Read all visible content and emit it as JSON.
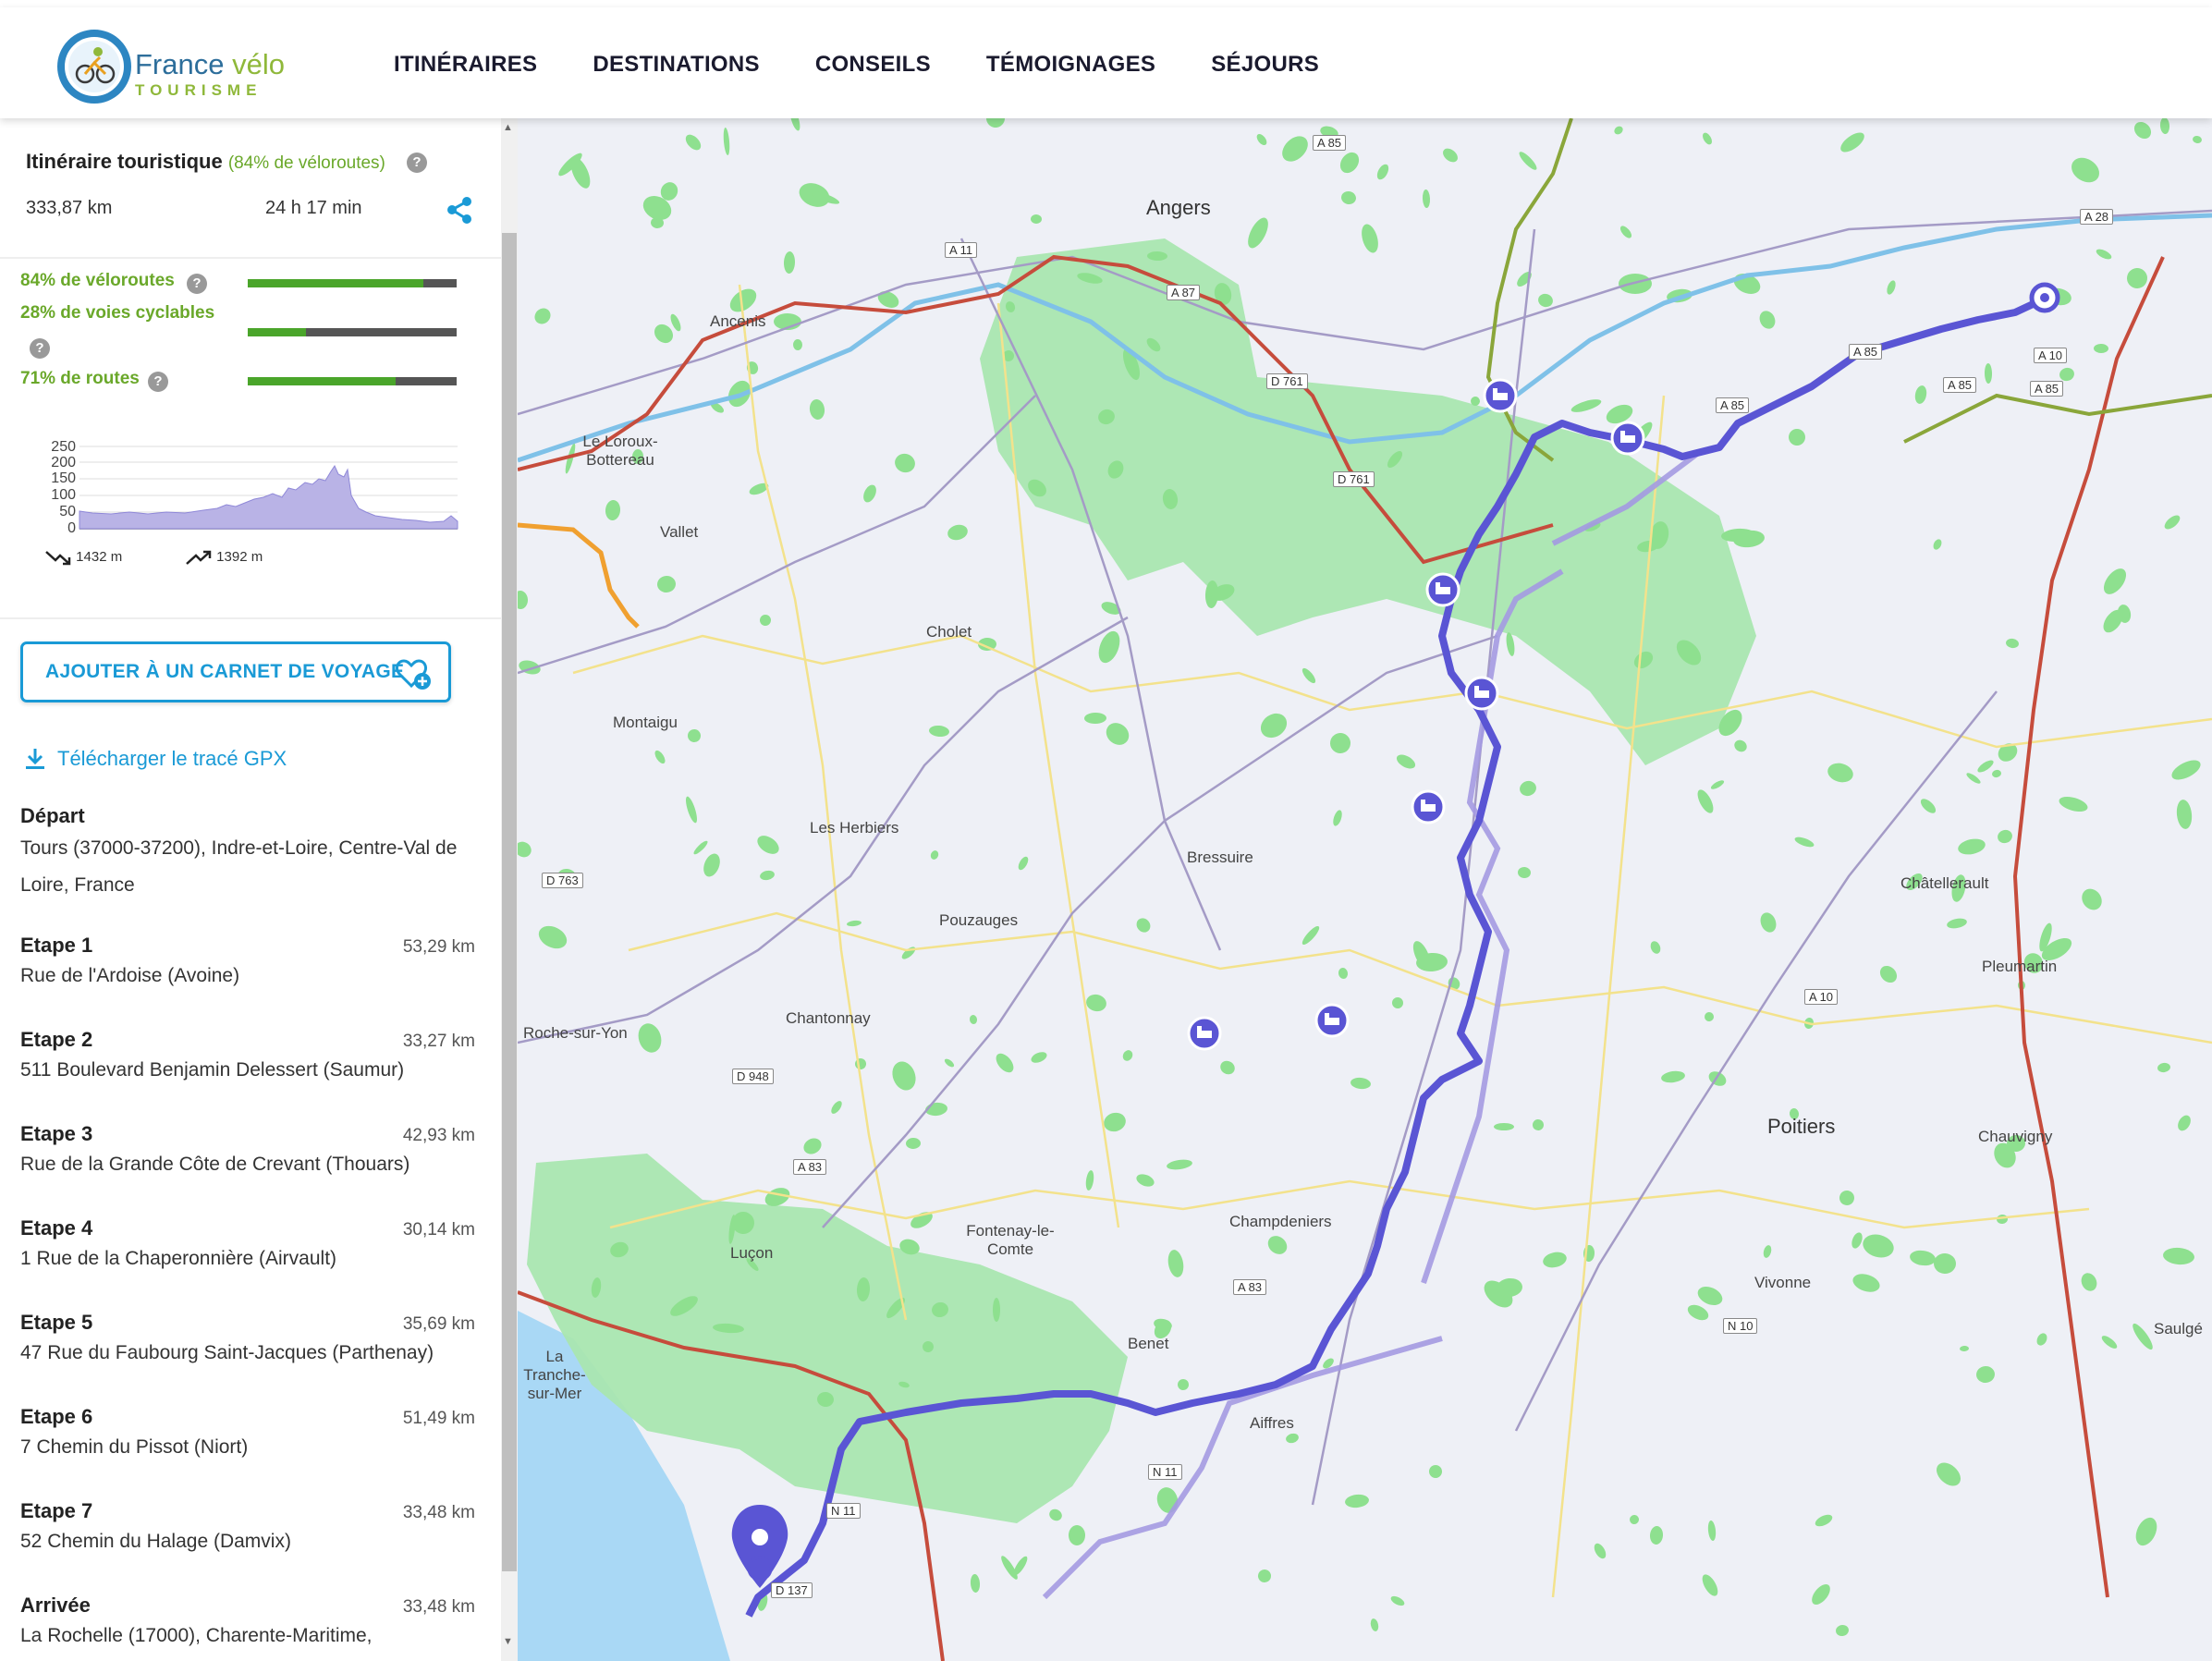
{
  "header": {
    "logo_line1": "France",
    "logo_line1b": "vélo",
    "logo_line2": "TOURISME",
    "nav": [
      "ITINÉRAIRES",
      "DESTINATIONS",
      "CONSEILS",
      "TÉMOIGNAGES",
      "SÉJOURS"
    ]
  },
  "summary": {
    "title": "Itinéraire touristique",
    "title_pct": "(84% de véloroutes)",
    "distance": "333,87 km",
    "duration": "24 h 17 min"
  },
  "stats": [
    {
      "label": "84% de véloroutes",
      "fraction": 0.84
    },
    {
      "label": "28% de voies cyclables",
      "fraction": 0.28
    },
    {
      "label": "71% de routes",
      "fraction": 0.71
    }
  ],
  "elevation": {
    "y_ticks": [
      "250",
      "200",
      "150",
      "100",
      "50",
      "0"
    ],
    "descent": "1432 m",
    "ascent": "1392 m"
  },
  "actions": {
    "carnet_label": "AJOUTER À UN CARNET DE VOYAGE",
    "gpx_label": "Télécharger le tracé GPX"
  },
  "steps": [
    {
      "name": "Départ",
      "km": "",
      "addr": "Tours (37000-37200), Indre-et-Loire, Centre-Val de Loire, France"
    },
    {
      "name": "Etape 1",
      "km": "53,29 km",
      "addr": "Rue de l'Ardoise (Avoine)"
    },
    {
      "name": "Etape 2",
      "km": "33,27 km",
      "addr": "511 Boulevard Benjamin Delessert (Saumur)"
    },
    {
      "name": "Etape 3",
      "km": "42,93 km",
      "addr": "Rue de la Grande Côte de Crevant (Thouars)"
    },
    {
      "name": "Etape 4",
      "km": "30,14 km",
      "addr": "1 Rue de la Chaperonnière (Airvault)"
    },
    {
      "name": "Etape 5",
      "km": "35,69 km",
      "addr": "47 Rue du Faubourg Saint-Jacques (Parthenay)"
    },
    {
      "name": "Etape 6",
      "km": "51,49 km",
      "addr": "7 Chemin du Pissot (Niort)"
    },
    {
      "name": "Etape 7",
      "km": "33,48 km",
      "addr": "52 Chemin du Halage (Damvix)"
    },
    {
      "name": "Arrivée",
      "km": "33,48 km",
      "addr": "La Rochelle (17000), Charente-Maritime,"
    }
  ],
  "map": {
    "places": [
      "Angers",
      "Ancenis",
      "Le Loroux-Bottereau",
      "Vallet",
      "Cholet",
      "Montaigu",
      "Les Herbiers",
      "Bressuire",
      "Pouzauges",
      "Chantonnay",
      "Roche-sur-Yon",
      "Luçon",
      "Fontenay-le-Comte",
      "Benet",
      "Aiffres",
      "Champdeniers",
      "Poitiers",
      "Châtellerault",
      "Pleumartin",
      "Chauvigny",
      "Vivonne",
      "Saulgé",
      "La Tranche-sur-Mer"
    ],
    "roads": [
      "A 85",
      "A 28",
      "A 11",
      "A 87",
      "D 761",
      "D 761",
      "A 85",
      "A 85",
      "A 85",
      "A 10",
      "A 85",
      "D 763",
      "D 948",
      "A 83",
      "A 83",
      "A 10",
      "N 10",
      "N 11",
      "N 11",
      "D 137"
    ]
  },
  "colors": {
    "accent": "#1a9ad6",
    "green": "#6aa82a",
    "route": "#5a55d4",
    "forest": "#a9e6b0"
  }
}
